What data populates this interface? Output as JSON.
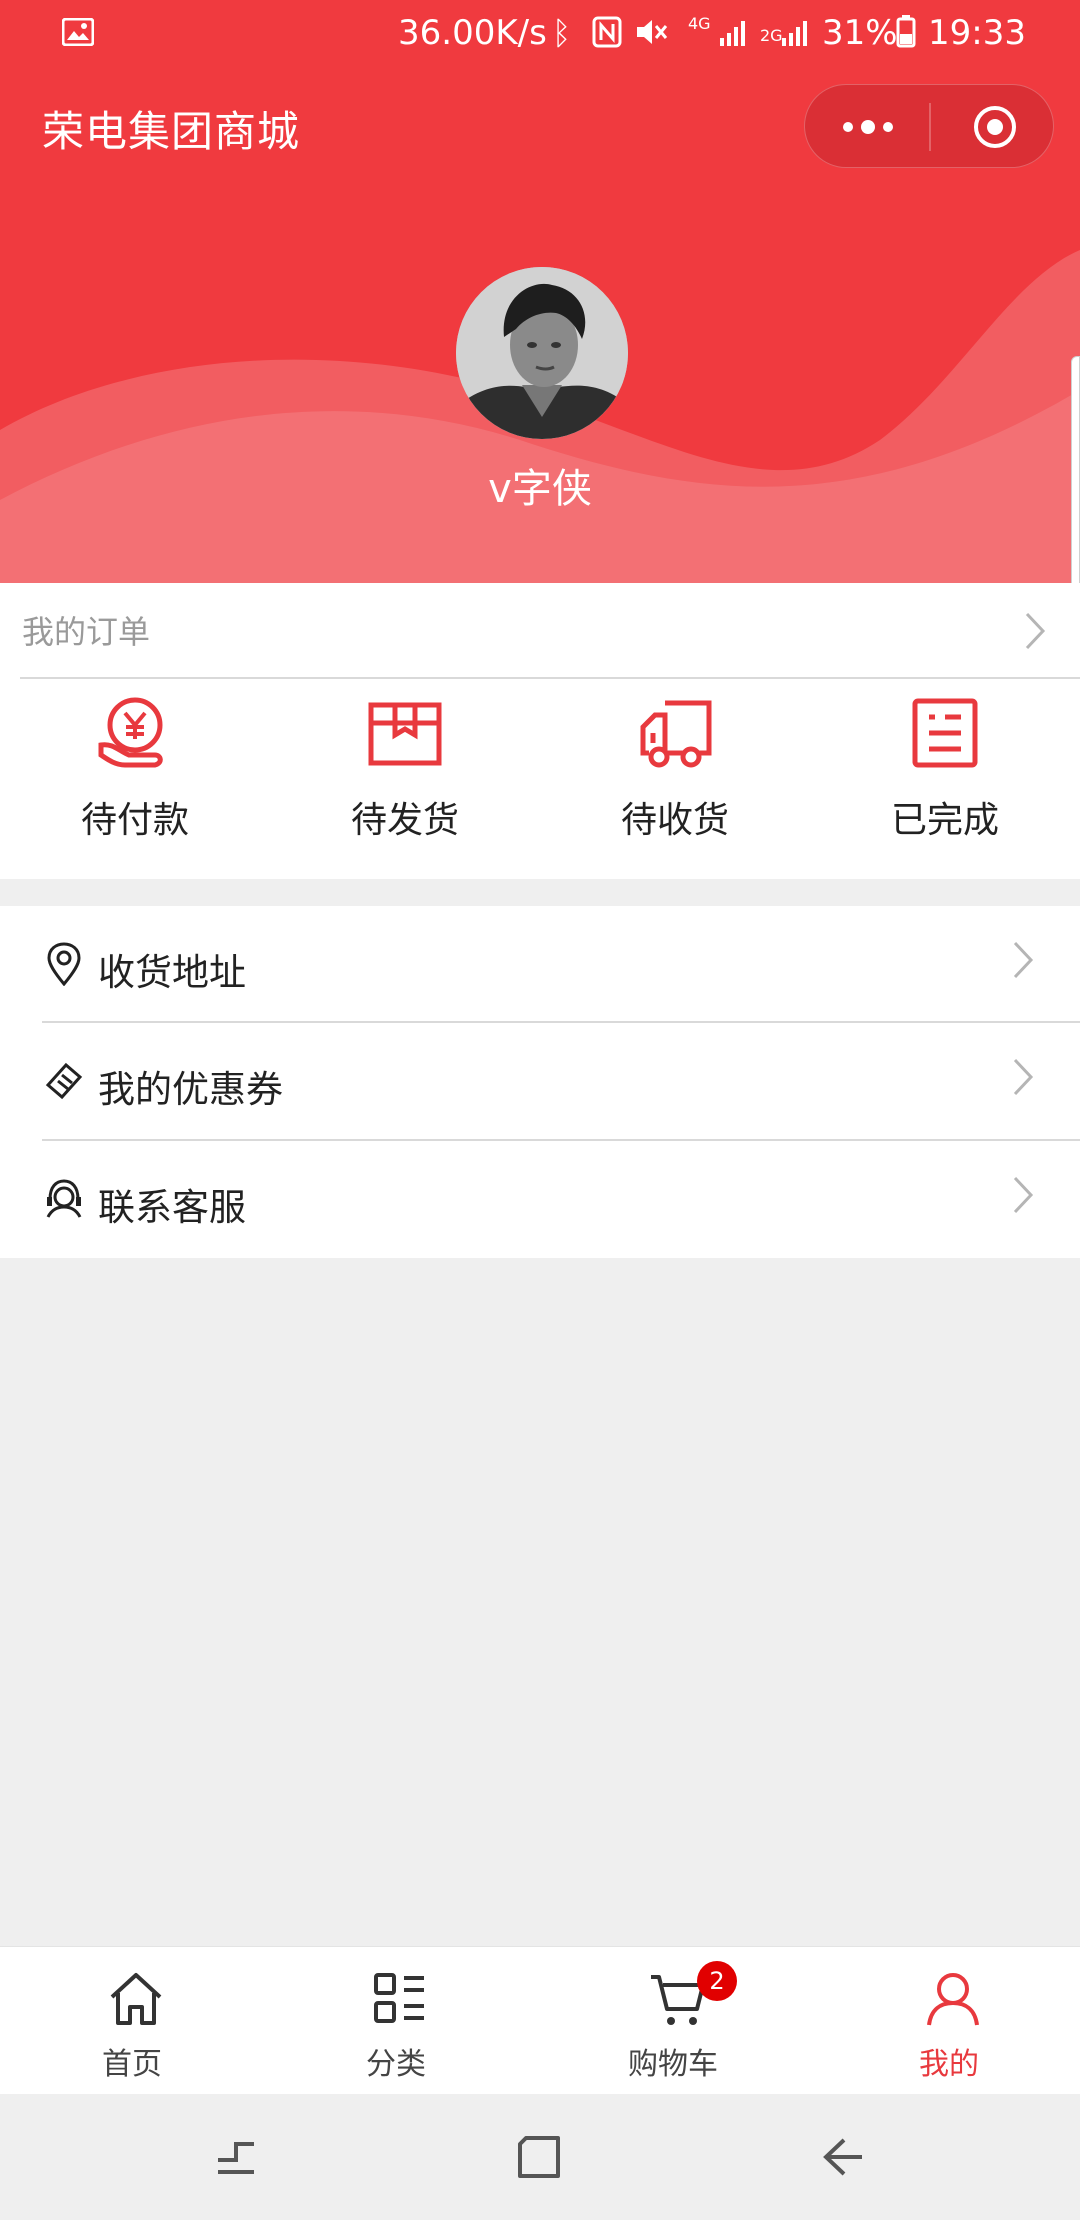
{
  "status_bar": {
    "speed": "36.00K/s",
    "network_4g": "4G",
    "network_2g": "2G",
    "battery": "31%",
    "time": "19:33"
  },
  "header": {
    "title": "荣电集团商城",
    "username": "v字侠",
    "accent_color": "#f03a3f"
  },
  "orders": {
    "title": "我的订单",
    "items": [
      {
        "label": "待付款",
        "icon": "payment-pending-icon"
      },
      {
        "label": "待发货",
        "icon": "package-icon"
      },
      {
        "label": "待收货",
        "icon": "delivery-truck-icon"
      },
      {
        "label": "已完成",
        "icon": "completed-list-icon"
      }
    ]
  },
  "menu": {
    "items": [
      {
        "label": "收货地址",
        "icon": "location-pin-icon"
      },
      {
        "label": "我的优惠券",
        "icon": "coupon-icon"
      },
      {
        "label": "联系客服",
        "icon": "customer-service-icon"
      }
    ]
  },
  "tabbar": {
    "items": [
      {
        "label": "首页",
        "icon": "home-icon",
        "active": false
      },
      {
        "label": "分类",
        "icon": "category-icon",
        "active": false
      },
      {
        "label": "购物车",
        "icon": "cart-icon",
        "active": false,
        "badge": "2"
      },
      {
        "label": "我的",
        "icon": "user-icon",
        "active": true
      }
    ],
    "active_color": "#e8393e"
  }
}
